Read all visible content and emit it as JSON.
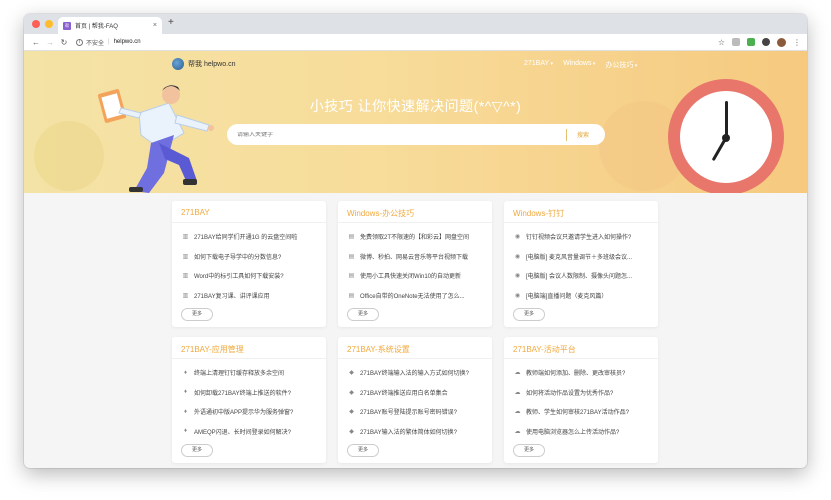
{
  "browser": {
    "tab_title": "首页 | 帮我-FAQ",
    "new_tab": "+",
    "close_tab": "×",
    "insecure_label": "不安全",
    "separator": "|",
    "url": "helpwo.cn",
    "traffic_lights": [
      "#fe5f57",
      "#febc2e",
      "#28c840"
    ]
  },
  "site": {
    "brand": "帮我 helpwo.cn",
    "nav": [
      "271BAY",
      "Windows",
      "办公技巧"
    ],
    "headline": "小技巧 让你快速解决问题(*^▽^*)",
    "search_placeholder": "请输入关键字",
    "search_button": "搜索",
    "accent_color": "#f0a93d"
  },
  "cards": [
    {
      "title": "271BAY",
      "icon": "chart-icon",
      "glyph": "▥",
      "items": [
        "271BAY给同学们开通1G 的云盘空间啦",
        "如何下载电子导学中的分数信息?",
        "Word中的标引工具如何下载安装?",
        "271BAY复习课、讲评课应用"
      ],
      "more": "更多"
    },
    {
      "title": "Windows-办公技巧",
      "icon": "document-icon",
      "glyph": "▤",
      "items": [
        "免费领取2T不限速的【和彩云】网盘空间",
        "微博、秒拍、网易云音乐等平台视频下载",
        "使用小工具快速关闭Win10的自动更新",
        "Office自带的OneNote无法使用了怎么..."
      ],
      "more": "更多"
    },
    {
      "title": "Windows-钉钉",
      "icon": "compass-icon",
      "glyph": "◉",
      "items": [
        "钉钉视频会议只邀请学生进入如何操作?",
        "[电脑版] 麦克风音量调节＋多班级会议...",
        "[电脑版] 会议人数限制、摄像头问题怎...",
        "[电脑端]直播问题（麦克风篇）"
      ],
      "more": "更多"
    },
    {
      "title": "271BAY-应用管理",
      "icon": "drop-icon",
      "glyph": "♦",
      "items": [
        "终端上清理钉钉缓存释放多余空间",
        "如何卸载271BAY终端上推送的软件?",
        "外语通初中版APP提示华为服务弹窗?",
        "AMEQP闪退、长时间登录如何解决?"
      ],
      "more": "更多"
    },
    {
      "title": "271BAY-系统设置",
      "icon": "diamond-icon",
      "glyph": "◆",
      "items": [
        "271BAY终端输入法的输入方式如何切换?",
        "271BAY终端推送应用白名单集合",
        "271BAY账号登陆提示账号密码错误?",
        "271BAY输入法的繁体简体如何切换?"
      ],
      "more": "更多"
    },
    {
      "title": "271BAY-活动平台",
      "icon": "cloud-icon",
      "glyph": "☁",
      "items": [
        "教师端如何添加、删除、更改审核员?",
        "如何将活动作品设置为优秀作品?",
        "教师、学生如何审核271BAY活动作品?",
        "使用电脑浏览器怎么上传活动作品?"
      ],
      "more": "更多"
    }
  ]
}
